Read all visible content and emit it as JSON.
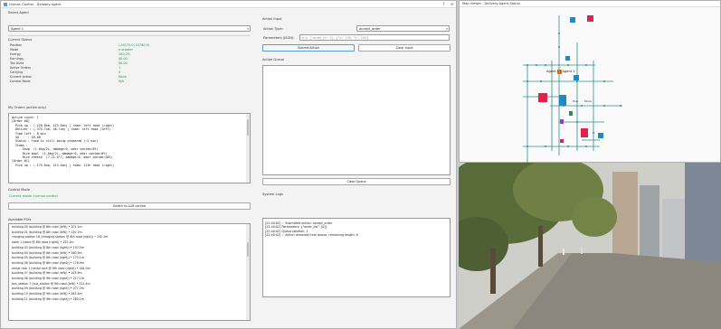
{
  "window": {
    "title": "Human Control - Delivery Agent",
    "min": "–",
    "max": "□",
    "close": "✕",
    "help": "?"
  },
  "left": {
    "select_agent_label": "Select Agent",
    "agent_value": "Agent 1",
    "status_label": "Current Status",
    "status": [
      {
        "k": "Position",
        "v": "(-40175.0, 23780.0)"
      },
      {
        "k": "Mode",
        "v": "e-scooter"
      },
      {
        "k": "Energy",
        "v": "100.0%"
      },
      {
        "k": "Earnings",
        "v": "$0.00"
      },
      {
        "k": "Tax Dues",
        "v": "$0.00"
      },
      {
        "k": "Active Orders",
        "v": "1"
      },
      {
        "k": "Carrying",
        "v": "0"
      },
      {
        "k": "Current Action",
        "v": "None"
      },
      {
        "k": "Control Mode",
        "v": "N/A"
      }
    ],
    "orders_label": "My Orders (active only)",
    "orders_text": [
      "Active count: 1",
      "[Order #0]",
      "  Pick up : (-220.0cm, 413.0cm) | road: left road (right)",
      "  Deliver : (-375.7cm, 48.7cm) | road: left road (left)",
      "  Time left : 8 min",
      "  $$     : $9.00",
      "  Status : food is still being prepared (~2 min)",
      "  Items :",
      "    - Soup  (1.0kg/2L, damage:0, odor contam:0%)",
      "    - Rice bowl  (1.0kg/2L, damage:0, odor contam:0%)",
      "    - Rice cheese  (7-21.0°C, damage:0, odor contam:20%)",
      "[Order #1]",
      "  Pick up : (-175.0cm, 413.0cm) | road: 11th road (right)"
    ],
    "control_mode_label": "Control Mode",
    "control_mode_status": "Current mode: Human control",
    "switch_button": "Switch to LLM control",
    "poi_label": "Available POIs",
    "pois": [
      "building 00 (building @ 8th road (left)) • 101.1m",
      "building 01 (building @ 8th road (left)) • 120.7m",
      "charging station 16 (charging station @ 8th road (right)) • 152.1m",
      "store 1 (store @ 8th road (right)) • 153.1m",
      "building 03 (building @ 8th road (right)) • 157.5m",
      "building 04 (building @ 8th road (left)) • 160.9m",
      "building 05 (building @ 8th road (right)) • 175.1m",
      "building 06 (building @ 8th road (right)) • 176.9m",
      "rental rack 1 (rental rack @ 9th road (right)) • 184.0m",
      "building 07 (building @ 9th road (left)) • 193.9m",
      "building 08 (building @ 9th road (right)) • 217.1m",
      "bus_station 1 (bus_station @ 9th road (left)) • 221.4m",
      "building 09 (building @ 9th road (right)) • 277.2m",
      "building 10 (building @ 9th road (left)) • 283.4m",
      "building 11 (building @ 9th road (right)) • 285.1m"
    ]
  },
  "right": {
    "action_input_label": "Action Input",
    "action_type_label": "Action Type:",
    "action_type_value": "accept_order",
    "params_label": "Parameters (JSON):",
    "params_placeholder": "e.g. {\"order_id\": 0}, {\"x\": 100, \"y\": 200}",
    "submit_button": "Submit Action",
    "clear_input_button": "Clear Input",
    "queue_label": "Action Queue",
    "clear_queue_button": "Clear Queue",
    "logs_label": "System Logs",
    "logs": [
      {
        "t": "[22:40:02]",
        "icon": "✓",
        "msg": "Submitted action: accept_order",
        "ok": false
      },
      {
        "t": "[22:40:02]",
        "icon": "",
        "msg": "Parameters: {\"order_ids\": [0]}",
        "ok": false
      },
      {
        "t": "[22:40:02]",
        "icon": "",
        "msg": "Queue position: 1",
        "ok": false
      },
      {
        "t": "[22:40:03]",
        "icon": "✓",
        "msg": "Action removed from queue, remaining length: 0",
        "ok": true
      }
    ]
  },
  "map": {
    "title": "Map Viewer - Delivery Agent Status",
    "agent_label": "Agent 1 | Agent 2",
    "labels": [
      "Hub",
      "Store",
      "Bus 1",
      "P1"
    ]
  },
  "colors": {
    "accent": "#5b9bd5",
    "status_green": "#2e8b57",
    "building_red": "#e0234a",
    "building_blue": "#1e88c8",
    "road": "#2f8f86"
  }
}
